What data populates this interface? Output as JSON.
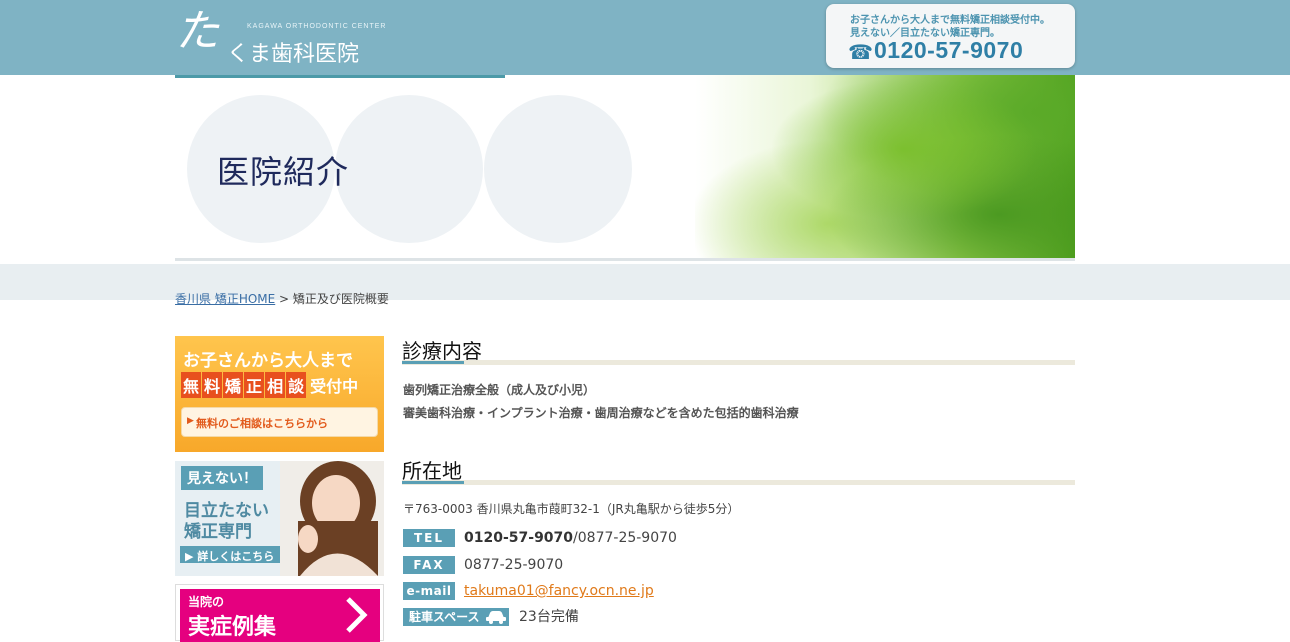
{
  "header": {
    "logo_mark": "た",
    "logo_en": "KAGAWA ORTHODONTIC CENTER",
    "logo_name": "くま歯科医院",
    "notice_line1": "お子さんから大人まで無料矯正相談受付中。",
    "notice_line2": "見えない／目立たない矯正専門。",
    "phone": "0120-57-9070",
    "phone_icon": "☎"
  },
  "banner": {
    "title": "医院紹介"
  },
  "breadcrumb": {
    "link1": "香川県 矯正HOME",
    "separator": " > ",
    "current": "矯正及び医院概要"
  },
  "sidebar": {
    "consult": {
      "line1": "お子さんから大人まで",
      "chars": [
        "無",
        "料",
        "矯",
        "正",
        "相",
        "談"
      ],
      "suffix": "受付中",
      "button": "無料のご相談はこちらから",
      "arrow": "▶"
    },
    "invisible": {
      "tag": "見えない！",
      "line2": "目立たない",
      "line3": "矯正専門",
      "button": "▶ 詳しくはこちら"
    },
    "cases": {
      "line1": "当院の",
      "line2": "実症例集"
    }
  },
  "main": {
    "section1": {
      "heading": "診療内容",
      "items": [
        "歯列矯正治療全般（成人及び小児）",
        "審美歯科治療・インプラント治療・歯周治療などを含めた包括的歯科治療"
      ]
    },
    "section2": {
      "heading": "所在地",
      "address": "〒763-0003 香川県丸亀市葭町32-1（JR丸亀駅から徒歩5分）",
      "tel_label": "TEL",
      "tel_free": "0120-57-9070",
      "tel_rest": "/0877-25-9070",
      "fax_label": "FAX",
      "fax": "0877-25-9070",
      "email_label": "e-mail",
      "email": "takuma01@fancy.ocn.ne.jp",
      "parking_label": "駐車スペース",
      "parking": "23台完備"
    }
  },
  "colors": {
    "header_bg": "#7fb3c4",
    "accent_blue": "#5a9fb5",
    "orange": "#f8a82a",
    "pink": "#e5007f",
    "link_orange": "#e07a1a"
  }
}
